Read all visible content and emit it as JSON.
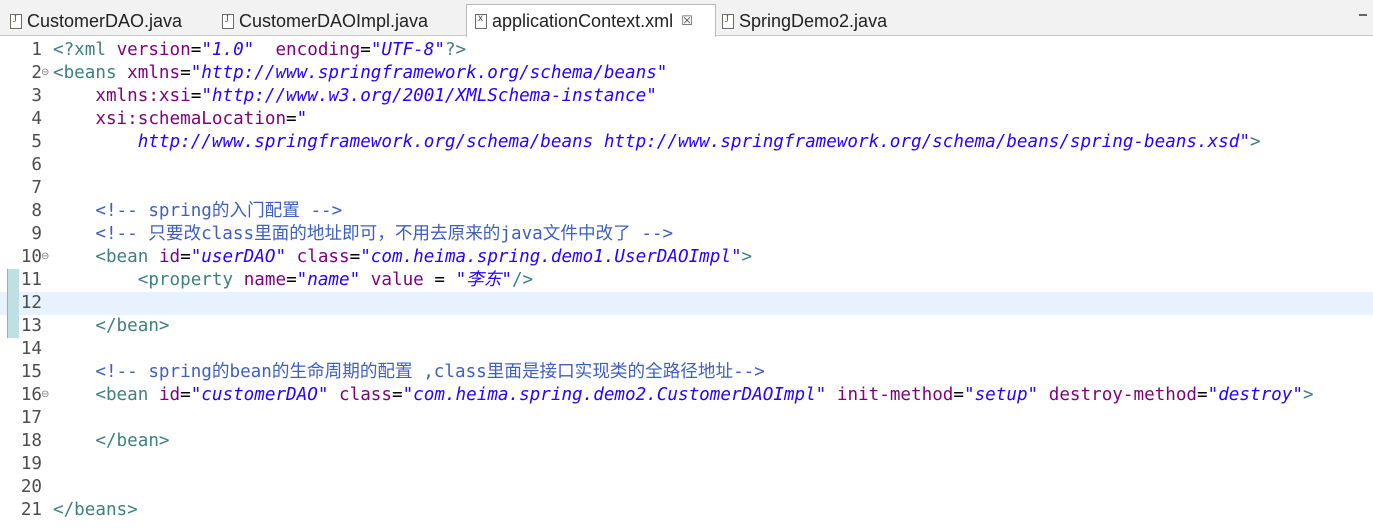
{
  "tabs": [
    {
      "label": "CustomerDAO.java",
      "icon": "java-file-icon",
      "active": false
    },
    {
      "label": "CustomerDAOImpl.java",
      "icon": "java-file-icon",
      "active": false
    },
    {
      "label": "applicationContext.xml",
      "icon": "xml-file-icon",
      "active": true,
      "close": "☒"
    },
    {
      "label": "SpringDemo2.java",
      "icon": "java-file-icon",
      "active": false
    }
  ],
  "current_line": 12,
  "lines": [
    {
      "n": "1",
      "t": [
        [
          "pi",
          "<?xml "
        ],
        [
          "attr",
          "version"
        ],
        [
          "",
          "="
        ],
        [
          "val",
          "\"1.0\""
        ],
        [
          "",
          "  "
        ],
        [
          "attr",
          "encoding"
        ],
        [
          "",
          "="
        ],
        [
          "val",
          "\"UTF-8\""
        ],
        [
          "pi",
          "?>"
        ]
      ]
    },
    {
      "n": "2",
      "fold": "⊖",
      "t": [
        [
          "tag",
          "<beans "
        ],
        [
          "attr",
          "xmlns"
        ],
        [
          "",
          "="
        ],
        [
          "val",
          "\"http://www.springframework.org/schema/beans\""
        ]
      ]
    },
    {
      "n": "3",
      "t": [
        [
          "",
          "    "
        ],
        [
          "attr",
          "xmlns:xsi"
        ],
        [
          "",
          "="
        ],
        [
          "val",
          "\"http://www.w3.org/2001/XMLSchema-instance\""
        ]
      ]
    },
    {
      "n": "4",
      "t": [
        [
          "",
          "    "
        ],
        [
          "attr",
          "xsi:schemaLocation"
        ],
        [
          "",
          "="
        ],
        [
          "val",
          "\""
        ]
      ]
    },
    {
      "n": "5",
      "t": [
        [
          "",
          "        "
        ],
        [
          "val",
          "http://www.springframework.org/schema/beans http://www.springframework.org/schema/beans/spring-beans.xsd\""
        ],
        [
          "tag",
          ">"
        ]
      ]
    },
    {
      "n": "6",
      "t": []
    },
    {
      "n": "7",
      "t": []
    },
    {
      "n": "8",
      "t": [
        [
          "",
          "    "
        ],
        [
          "cmt",
          "<!-- spring的入门配置 -->"
        ]
      ]
    },
    {
      "n": "9",
      "t": [
        [
          "",
          "    "
        ],
        [
          "cmt",
          "<!-- 只要改class里面的地址即可，不用去原来的java文件中改了 -->"
        ]
      ]
    },
    {
      "n": "10",
      "fold": "⊖",
      "t": [
        [
          "",
          "    "
        ],
        [
          "tag",
          "<bean "
        ],
        [
          "attr",
          "id"
        ],
        [
          "",
          "="
        ],
        [
          "val",
          "\"userDAO\""
        ],
        [
          "",
          "",
          " "
        ],
        [
          "attr",
          " class"
        ],
        [
          "",
          "="
        ],
        [
          "val",
          "\"com.heima.spring.demo1.UserDAOImpl\""
        ],
        [
          "tag",
          ">"
        ]
      ]
    },
    {
      "n": "11",
      "t": [
        [
          "",
          "        "
        ],
        [
          "tag",
          "<property "
        ],
        [
          "attr",
          "name"
        ],
        [
          "",
          "="
        ],
        [
          "val",
          "\"name\""
        ],
        [
          "",
          "",
          " "
        ],
        [
          "attr",
          " value"
        ],
        [
          "",
          " = "
        ],
        [
          "val",
          "\"李东\""
        ],
        [
          "tag",
          "/>"
        ]
      ]
    },
    {
      "n": "12",
      "t": []
    },
    {
      "n": "13",
      "t": [
        [
          "",
          "    "
        ],
        [
          "tag",
          "</bean>"
        ]
      ]
    },
    {
      "n": "14",
      "t": []
    },
    {
      "n": "15",
      "t": [
        [
          "",
          "    "
        ],
        [
          "cmt",
          "<!-- spring的bean的生命周期的配置 ,class里面是接口实现类的全路径地址-->"
        ]
      ]
    },
    {
      "n": "16",
      "fold": "⊖",
      "t": [
        [
          "",
          "    "
        ],
        [
          "tag",
          "<bean "
        ],
        [
          "attr",
          "id"
        ],
        [
          "",
          "="
        ],
        [
          "val",
          "\"customerDAO\""
        ],
        [
          "attr",
          " class"
        ],
        [
          "",
          "="
        ],
        [
          "val",
          "\"com.heima.spring.demo2.CustomerDAOImpl\""
        ],
        [
          "attr",
          " init-method"
        ],
        [
          "",
          "="
        ],
        [
          "val",
          "\"setup\""
        ],
        [
          "attr",
          " destroy-method"
        ],
        [
          "",
          "="
        ],
        [
          "val",
          "\"destroy\""
        ],
        [
          "tag",
          ">"
        ]
      ]
    },
    {
      "n": "17",
      "t": []
    },
    {
      "n": "18",
      "t": [
        [
          "",
          "    "
        ],
        [
          "tag",
          "</bean>"
        ]
      ]
    },
    {
      "n": "19",
      "t": []
    },
    {
      "n": "20",
      "t": []
    },
    {
      "n": "21",
      "t": [
        [
          "tag",
          "</beans>"
        ]
      ]
    }
  ]
}
